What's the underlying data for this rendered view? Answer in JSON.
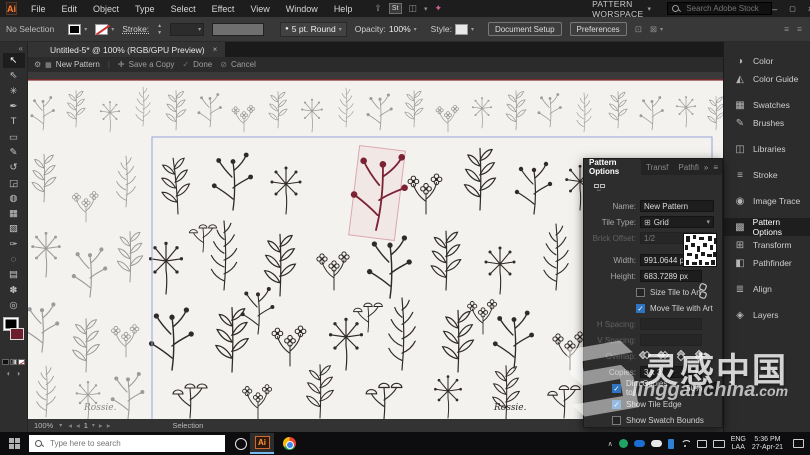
{
  "app": {
    "logo": "Ai",
    "workspace": "PATTERN WORSPACE",
    "search_placeholder": "Search Adobe Stock",
    "stock_badge": "St"
  },
  "menus": [
    "File",
    "Edit",
    "Object",
    "Type",
    "Select",
    "Effect",
    "View",
    "Window",
    "Help"
  ],
  "control_bar": {
    "no_selection": "No Selection",
    "stroke_label": "Stroke:",
    "brush": "5 pt. Round",
    "opacity_label": "Opacity:",
    "opacity_value": "100%",
    "style_label": "Style:",
    "document_setup": "Document Setup",
    "preferences": "Preferences"
  },
  "document": {
    "tab_title": "Untitled-5* @ 100% (RGB/GPU Preview)"
  },
  "pattern_bar": {
    "pattern_name": "New Pattern",
    "save_copy": "Save a Copy",
    "done": "Done",
    "cancel": "Cancel"
  },
  "tools": [
    {
      "name": "selection",
      "glyph": "↖"
    },
    {
      "name": "direct-selection",
      "glyph": "⇖"
    },
    {
      "name": "magic-wand",
      "glyph": "✳"
    },
    {
      "name": "pen",
      "glyph": "✒"
    },
    {
      "name": "type",
      "glyph": "T"
    },
    {
      "name": "rectangle",
      "glyph": "▭"
    },
    {
      "name": "paintbrush",
      "glyph": "✎"
    },
    {
      "name": "rotate",
      "glyph": "↺"
    },
    {
      "name": "scale",
      "glyph": "◲"
    },
    {
      "name": "shape-builder",
      "glyph": "◍"
    },
    {
      "name": "mesh",
      "glyph": "▦"
    },
    {
      "name": "gradient",
      "glyph": "▧"
    },
    {
      "name": "eyedropper",
      "glyph": "✑"
    },
    {
      "name": "symbol-sprayer",
      "glyph": "◌"
    },
    {
      "name": "graph",
      "glyph": "▤"
    },
    {
      "name": "hand",
      "glyph": "✽"
    },
    {
      "name": "zoom",
      "glyph": "◎"
    }
  ],
  "dock": {
    "items": [
      {
        "icon": "◑",
        "label": "Color"
      },
      {
        "icon": "◭",
        "label": "Color Guide"
      },
      {
        "icon": "▦",
        "label": "Swatches"
      },
      {
        "icon": "✎",
        "label": "Brushes"
      },
      {
        "icon": "◫",
        "label": "Libraries"
      },
      {
        "icon": "≡",
        "label": "Stroke"
      },
      {
        "icon": "◉",
        "label": "Image Trace"
      },
      {
        "icon": "▩",
        "label": "Pattern Options"
      },
      {
        "icon": "⊞",
        "label": "Transform"
      },
      {
        "icon": "◧",
        "label": "Pathfinder"
      },
      {
        "icon": "≣",
        "label": "Align"
      },
      {
        "icon": "◈",
        "label": "Layers"
      }
    ]
  },
  "panel": {
    "tabs": [
      "Pattern Options",
      "Transf",
      "Pathfi"
    ],
    "name_label": "Name:",
    "name_value": "New Pattern",
    "tile_type_label": "Tile Type:",
    "tile_type_value": "Grid",
    "brick_offset_label": "Brick Offset:",
    "brick_offset_value": "1/2",
    "width_label": "Width:",
    "width_value": "991.0644 px",
    "height_label": "Height:",
    "height_value": "683.7289 px",
    "size_tile_label": "Size Tile to Art",
    "size_tile_checked": false,
    "move_tile_label": "Move Tile with Art",
    "move_tile_checked": true,
    "h_spacing_label": "H Spacing:",
    "v_spacing_label": "V Spacing:",
    "overlap_label": "Overlap:",
    "copies_label": "Copies:",
    "copies_value": "3 x 3",
    "dim_label": "Dim Copies to:",
    "dim_value": "50%",
    "dim_checked": true,
    "show_tile_edge_label": "Show Tile Edge",
    "show_tile_edge_checked": true,
    "show_swatch_label": "Show Swatch Bounds",
    "show_swatch_checked": false
  },
  "status_bar": {
    "zoom": "100%",
    "artboard": "1",
    "tool": "Selection"
  },
  "artwork": {
    "signature": "Rossie."
  },
  "watermark": {
    "cn": "灵感中国",
    "en": "lingganchina",
    "tld": ".com"
  },
  "taskbar": {
    "search_placeholder": "Type here to search",
    "lang_line1": "ENG",
    "lang_line2": "LAA",
    "time": "5:36 PM",
    "date": "27-Apr-21"
  },
  "colors": {
    "accent_blue": "#2f74c0",
    "tile_edge": "#99a1d8",
    "selection_red": "#7b2233",
    "ai_orange": "#ff9a3e"
  }
}
